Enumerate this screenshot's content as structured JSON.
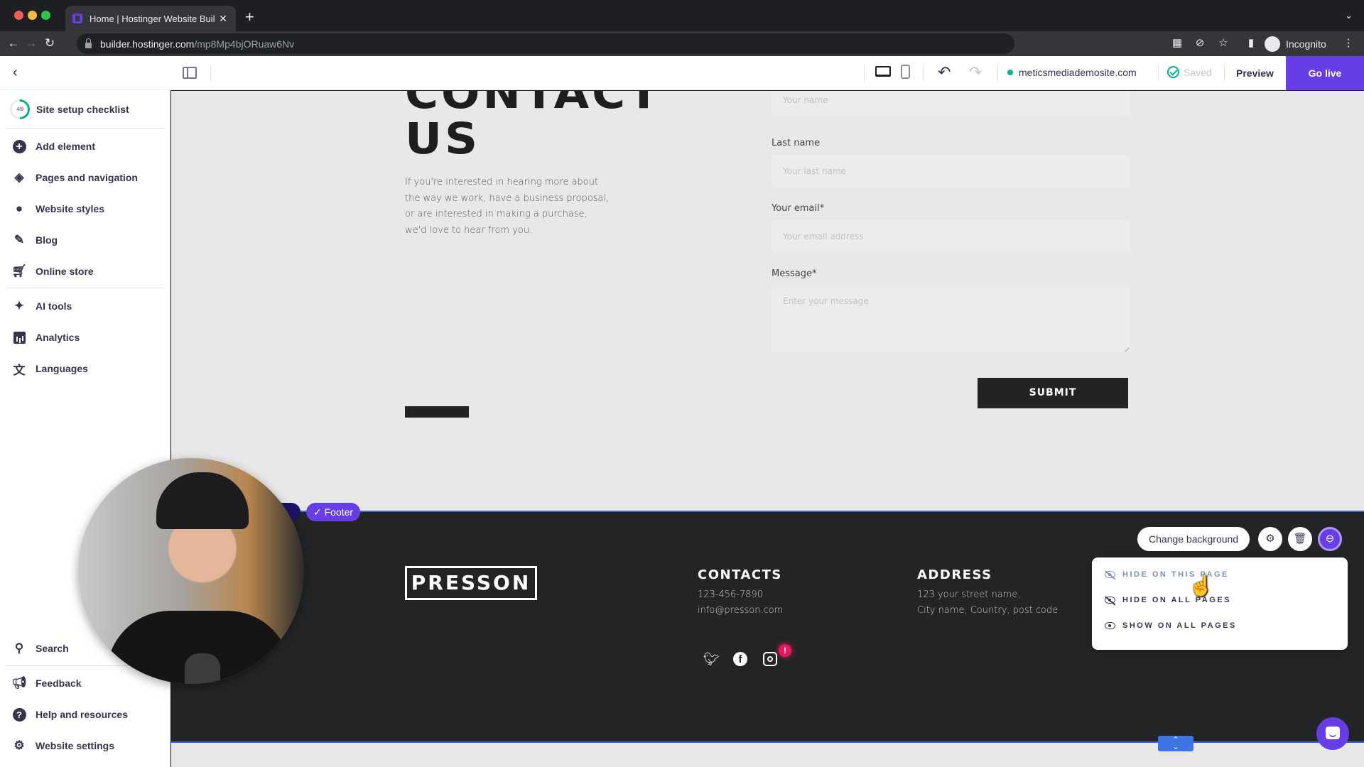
{
  "browser": {
    "tab_title": "Home | Hostinger Website Buil",
    "url_host": "builder.hostinger.com",
    "url_path": "/mp8Mp4bjORuaw6Nv",
    "profile_label": "Incognito"
  },
  "topbar": {
    "domain": "meticsmediademosite.com",
    "saved_label": "Saved",
    "preview_label": "Preview",
    "go_live_label": "Go live"
  },
  "sidebar": {
    "checklist": {
      "label": "Site setup checklist",
      "progress": "4/9"
    },
    "items": [
      {
        "label": "Add element",
        "icon": "plus-circle-icon"
      },
      {
        "label": "Pages and navigation",
        "icon": "layers-icon"
      },
      {
        "label": "Website styles",
        "icon": "palette-icon"
      },
      {
        "label": "Blog",
        "icon": "pen-icon"
      },
      {
        "label": "Online store",
        "icon": "cart-icon"
      },
      {
        "label": "AI tools",
        "icon": "sparkles-icon"
      },
      {
        "label": "Analytics",
        "icon": "bar-chart-icon"
      },
      {
        "label": "Languages",
        "icon": "translate-icon"
      }
    ],
    "bottom_items": [
      {
        "label": "Search",
        "icon": "search-icon"
      },
      {
        "label": "Feedback",
        "icon": "megaphone-icon"
      },
      {
        "label": "Help and resources",
        "icon": "help-icon"
      },
      {
        "label": "Website settings",
        "icon": "gear-icon"
      }
    ]
  },
  "contact": {
    "heading_line1": "CONTACT",
    "heading_line2": "US",
    "description": "If you're interested in hearing more about the way we work, have a business proposal, or are interested in making a purchase, we'd love to hear from you.",
    "form": {
      "name_placeholder": "Your name",
      "last_name_label": "Last name",
      "last_name_placeholder": "Your last name",
      "email_label": "Your email*",
      "email_placeholder": "Your email address",
      "message_label": "Message*",
      "message_placeholder": "Enter your message",
      "submit_label": "SUBMIT"
    }
  },
  "footer": {
    "section_tag": "Footer",
    "logo_text": "PRESSON",
    "contacts_heading": "CONTACTS",
    "phone": "123-456-7890",
    "email": "info@presson.com",
    "address_heading": "ADDRESS",
    "address_line1": "123 your street name,",
    "address_line2": "City name, Country, post code",
    "alert_badge": "!"
  },
  "section_toolbar": {
    "change_background_label": "Change background"
  },
  "visibility_menu": {
    "items": [
      {
        "label": "HIDE ON THIS PAGE",
        "state": "hovered"
      },
      {
        "label": "HIDE ON ALL PAGES",
        "state": "normal"
      },
      {
        "label": "SHOW ON ALL PAGES",
        "state": "normal"
      }
    ]
  },
  "colors": {
    "brand": "#673de6",
    "selection": "#3d74e6",
    "success": "#00b090",
    "footer_bg": "#232426"
  }
}
